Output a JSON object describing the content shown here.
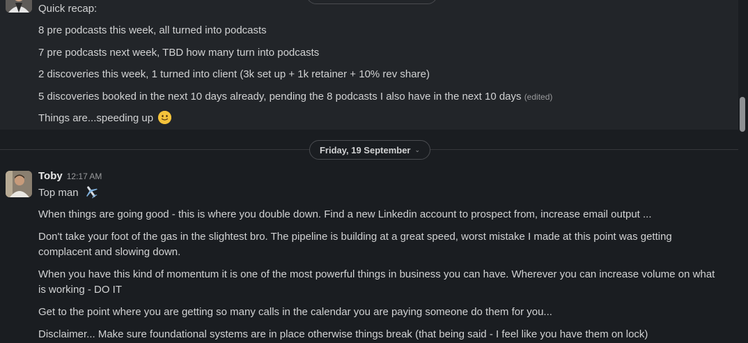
{
  "top_message": {
    "lines": [
      "Quick recap:",
      "8 pre podcasts this week, all turned into podcasts",
      "7 pre podcasts next week, TBD how many turn into podcasts",
      "2 discoveries this week, 1 turned into client (3k set up + 1k retainer + 10% rev share)",
      "5 discoveries booked in the next 10 days already, pending the 8 podcasts I also have in the next 10 days",
      "Things are...speeding up"
    ],
    "edited_label": "(edited)",
    "emoji": "slightly-smiling-face"
  },
  "date_divider": {
    "label": "Friday, 19 September",
    "chevron": "⌄"
  },
  "toby_message": {
    "sender": "Toby",
    "time": "12:17 AM",
    "first_line": "Top man",
    "emoji": "airplane",
    "lines": [
      "When things are going good - this is where you double down. Find a new Linkedin account to prospect from, increase email output ...",
      "Don't take your foot of the gas in the slightest bro. The pipeline is building at a great speed, worst mistake I made at this point was getting complacent and slowing down.",
      "When you have this kind of momentum it is one of the most powerful things in business you can have. Wherever you can increase volume on what is working - DO IT",
      "Get to the point where you are getting so many calls in the calendar you are paying someone do them for you...",
      "Disclaimer... Make sure foundational systems are in place otherwise things break (that being said - I feel like you have them on lock)"
    ]
  },
  "colors": {
    "background": "#1a1d21",
    "hover_background": "#222529",
    "text": "#d1d2d3",
    "muted": "#9a9b9d"
  }
}
